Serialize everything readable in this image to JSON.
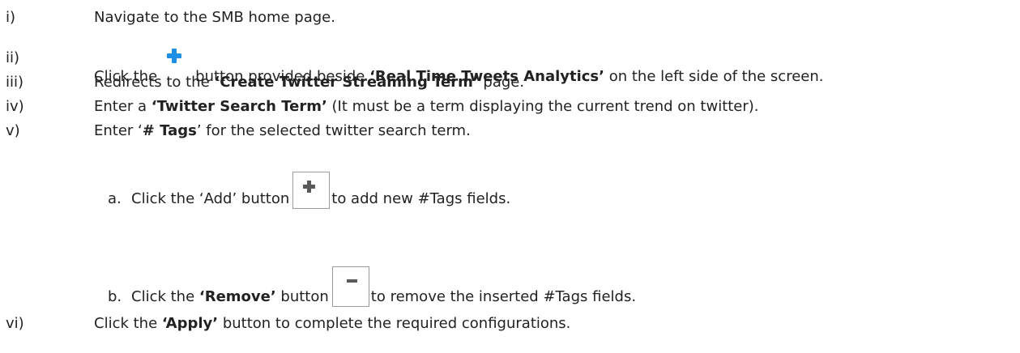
{
  "steps": [
    {
      "num": "i)",
      "text": "Navigate to the SMB home page."
    },
    {
      "num": "ii)",
      "pre": "Click the",
      "icon": "blue-plus-icon",
      "mid": "button provided beside ",
      "bold1": "‘Real Time Tweets Analytics’",
      "post": " on the left side of the screen."
    },
    {
      "num": "iii)",
      "pre": "Redirects to the ",
      "bold1": "‘Create Twitter Streaming Term’",
      "post": " page."
    },
    {
      "num": "iv)",
      "pre": "Enter a ",
      "bold1": "‘Twitter Search Term’",
      "post": " (It must be a term displaying the current trend on twitter)."
    },
    {
      "num": "v)",
      "pre": "Enter ‘",
      "bold1": "# Tags",
      "post": "’ for the selected twitter search term."
    },
    {
      "num": "vi)",
      "pre": "Click the ",
      "bold1": "‘Apply’",
      "post": " button to complete the required configurations."
    }
  ],
  "substeps": [
    {
      "letter": "a.",
      "pre": "Click the ‘Add’ button",
      "icon": "add-box-icon",
      "post": "to add new #Tags fields."
    },
    {
      "letter": "b.",
      "pre": "Click the ",
      "bold1": "‘Remove’",
      "mid": " button",
      "icon": "remove-box-icon",
      "post": "to remove the inserted #Tags fields."
    }
  ]
}
